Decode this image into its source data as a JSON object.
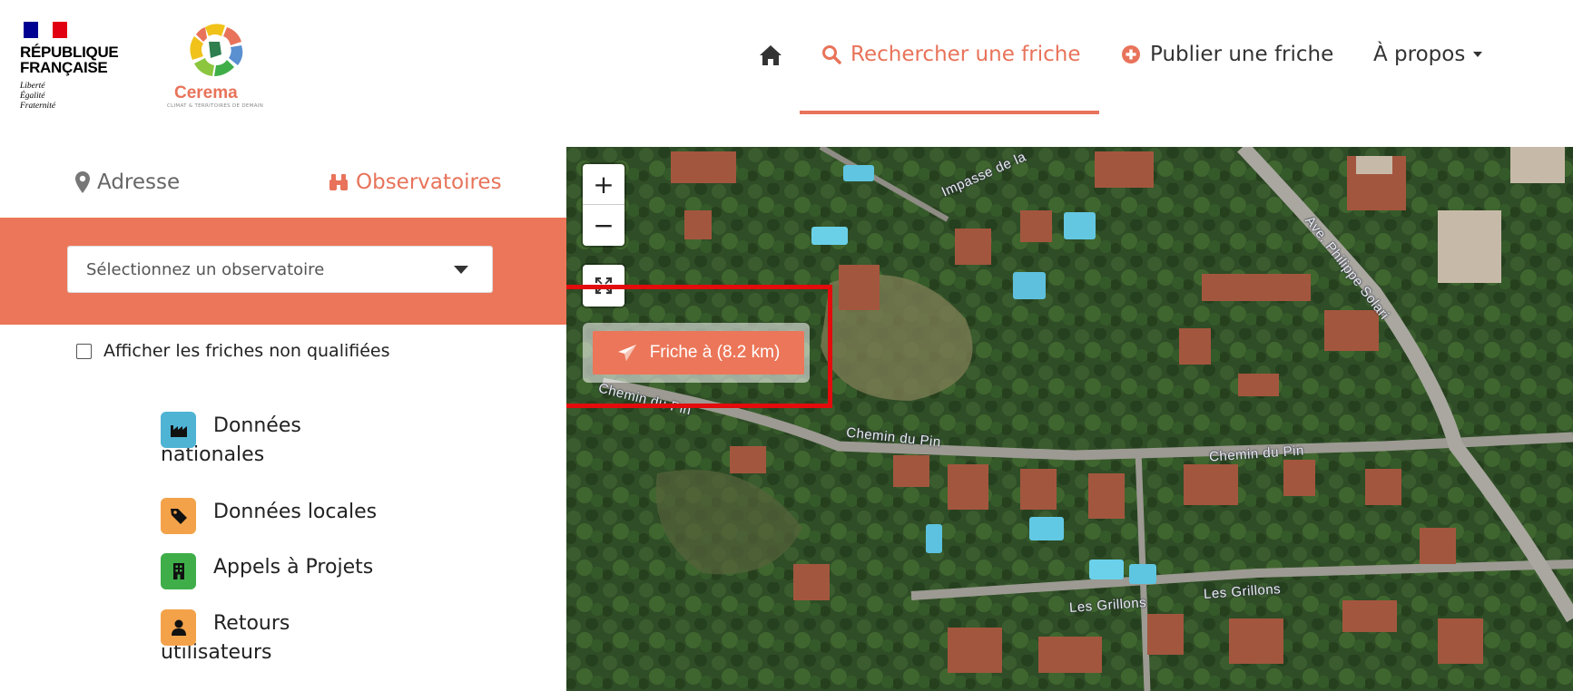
{
  "header": {
    "gov_logo": {
      "title_line1": "RÉPUBLIQUE",
      "title_line2": "FRANÇAISE",
      "motto_line1": "Liberté",
      "motto_line2": "Égalité",
      "motto_line3": "Fraternité"
    },
    "partner_logo": {
      "name": "Cerema",
      "tagline": "CLIMAT & TERRITOIRES DE DEMAIN"
    },
    "nav": {
      "home_icon": "home-icon",
      "search_label": "Rechercher une friche",
      "publish_label": "Publier une friche",
      "about_label": "À propos"
    }
  },
  "panel": {
    "tabs": [
      {
        "label": "Adresse",
        "icon": "map-marker-icon"
      },
      {
        "label": "Observatoires",
        "icon": "binoculars-icon",
        "active": true
      }
    ],
    "select_placeholder": "Sélectionnez un observatoire",
    "checkbox_label": "Afficher les friches non qualifiées",
    "legend": [
      {
        "line1": "Données",
        "line2": "nationales",
        "icon": "factory-icon",
        "color": "#4fb3d4"
      },
      {
        "line1": "Données locales",
        "line2": "",
        "icon": "tag-icon",
        "color": "#f3a24a"
      },
      {
        "line1": "Appels à Projets",
        "line2": "",
        "icon": "building-icon",
        "color": "#3fae49"
      },
      {
        "line1": "Retours",
        "line2": "utilisateurs",
        "icon": "user-icon",
        "color": "#f3a24a"
      }
    ]
  },
  "map": {
    "zoom_in": "+",
    "zoom_out": "−",
    "locate_button": "Friche à (8.2 km)",
    "streets": [
      "Impasse de la",
      "Ave. Philippe Solari",
      "Chemin du Pin",
      "Chemin du Pin",
      "Chemin du Pin",
      "Les Grillons",
      "Les Grillons"
    ]
  },
  "colors": {
    "accent": "#ec7659",
    "highlight": "#e30b0b"
  }
}
